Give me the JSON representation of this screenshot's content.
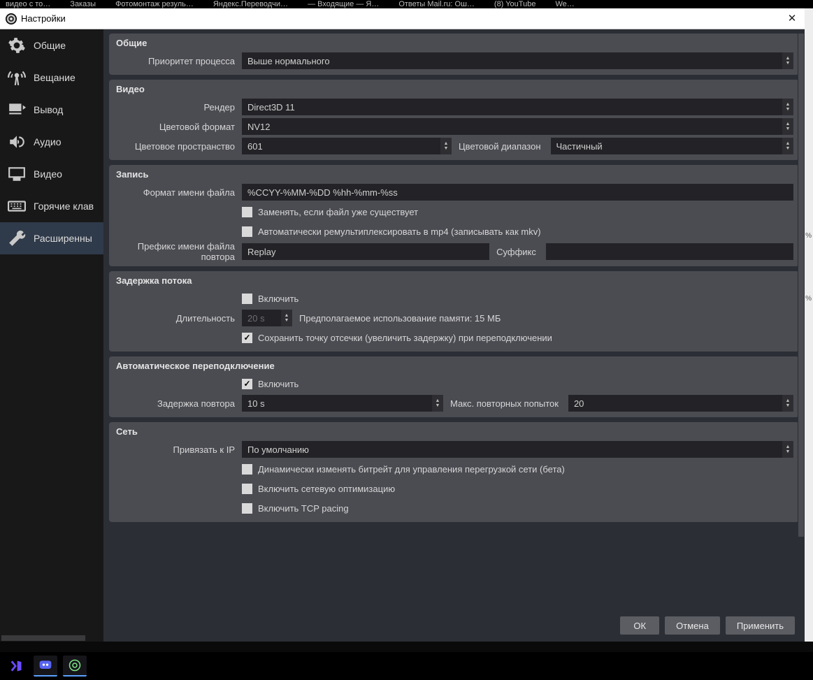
{
  "browser_tabs": [
    "видео с то…",
    "Заказы",
    "Фотомонтаж резуль…",
    "Яндекс.Переводчи…",
    "— Входящие — Я…",
    "Ответы Mail.ru: Ош…",
    "(8) YouTube",
    "We…"
  ],
  "title": "Настройки",
  "close_glyph": "✕",
  "sidebar": {
    "items": [
      {
        "label": "Общие",
        "icon": "gear"
      },
      {
        "label": "Вещание",
        "icon": "antenna"
      },
      {
        "label": "Вывод",
        "icon": "output"
      },
      {
        "label": "Аудио",
        "icon": "speaker"
      },
      {
        "label": "Видео",
        "icon": "monitor"
      },
      {
        "label": "Горячие клав",
        "icon": "keyboard"
      },
      {
        "label": "Расширенны",
        "icon": "wrench"
      }
    ],
    "selected_index": 6
  },
  "general": {
    "title": "Общие",
    "priority_label": "Приоритет процесса",
    "priority_value": "Выше нормального"
  },
  "video": {
    "title": "Видео",
    "renderer_label": "Рендер",
    "renderer_value": "Direct3D 11",
    "colorfmt_label": "Цветовой формат",
    "colorfmt_value": "NV12",
    "colorspace_label": "Цветовое пространство",
    "colorspace_value": "601",
    "colorrange_label": "Цветовой диапазон",
    "colorrange_value": "Частичный"
  },
  "recording": {
    "title": "Запись",
    "filenamefmt_label": "Формат имени файла",
    "filenamefmt_value": "%CCYY-%MM-%DD %hh-%mm-%ss",
    "overwrite_label": "Заменять, если файл уже существует",
    "remuxmp4_label": "Автоматически ремультиплексировать в mp4 (записывать как mkv)",
    "replayprefix_label": "Префикс имени файла повтора",
    "replayprefix_value": "Replay",
    "suffix_label": "Суффикс",
    "suffix_value": ""
  },
  "streamdelay": {
    "title": "Задержка потока",
    "enable_label": "Включить",
    "duration_label": "Длительность",
    "duration_value": "20 s",
    "mem_hint": "Предполагаемое использование памяти: 15 МБ",
    "preserve_label": "Сохранить точку отсечки (увеличить задержку) при переподключении"
  },
  "reconnect": {
    "title": "Автоматическое переподключение",
    "enable_label": "Включить",
    "retry_delay_label": "Задержка повтора",
    "retry_delay_value": "10 s",
    "max_retries_label": "Макс. повторных попыток",
    "max_retries_value": "20"
  },
  "network": {
    "title": "Сеть",
    "bind_label": "Привязать к IP",
    "bind_value": "По умолчанию",
    "dyn_bitrate_label": "Динамически изменять битрейт для управления перегрузкой сети (бета)",
    "netopt_label": "Включить сетевую оптимизацию",
    "tcppacing_label": "Включить TCP pacing"
  },
  "buttons": {
    "ok": "ОК",
    "cancel": "Отмена",
    "apply": "Применить"
  },
  "bg_pct": "%"
}
